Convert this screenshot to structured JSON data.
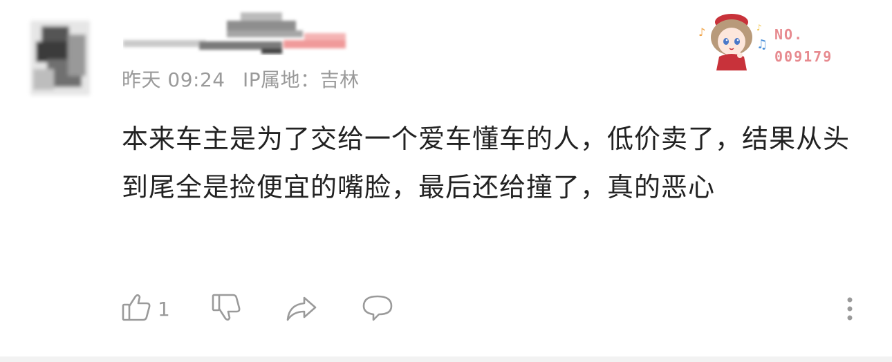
{
  "comment": {
    "username": "",
    "time": "昨天 09:24",
    "ip_location": "IP属地：吉林",
    "text": "本来车主是为了交给一个爱车懂车的人，低价卖了，结果从头到尾全是捡便宜的嘴脸，最后还给撞了，真的恶心"
  },
  "badge": {
    "label": "NO.",
    "number": "009179",
    "accent_color": "#e78a8f"
  },
  "actions": {
    "like_count": "1",
    "icons": [
      "thumbs-up-icon",
      "thumbs-down-icon",
      "share-icon",
      "comment-icon",
      "more-vertical-icon"
    ]
  }
}
